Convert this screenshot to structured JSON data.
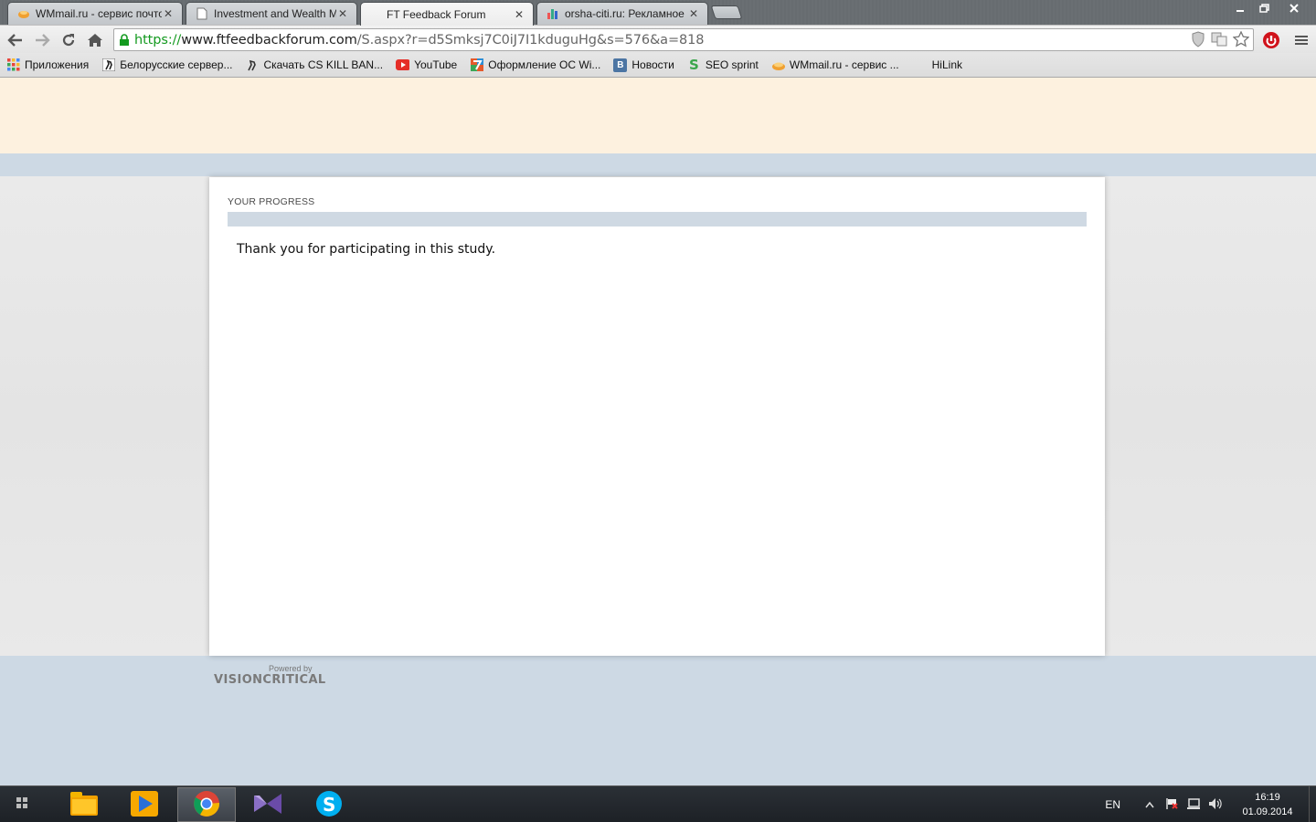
{
  "browser": {
    "tabs": [
      {
        "title": "WMmail.ru - сервис почтов",
        "icon": "wmmail-icon",
        "active": false
      },
      {
        "title": "Investment and Wealth Ma",
        "icon": "page-icon",
        "active": false
      },
      {
        "title": "FT Feedback Forum",
        "icon": "none",
        "active": true
      },
      {
        "title": "orsha-citi.ru: Рекламное аг",
        "icon": "chart-icon",
        "active": false
      }
    ],
    "close_glyph": "✕",
    "url": {
      "scheme": "https://",
      "host": "www.ftfeedbackforum.com",
      "path": "/S.aspx?r=d5Smksj7C0iJ7I1kduguHg&s=576&a=818"
    },
    "bookmarks": [
      {
        "label": "Приложения",
        "icon": "apps-icon",
        "color": "#e8453c"
      },
      {
        "label": "Белорусские сервер...",
        "icon": "cs-icon",
        "color": "#333333"
      },
      {
        "label": "Скачать CS KILL BAN...",
        "icon": "cs-icon",
        "color": "#333333"
      },
      {
        "label": "YouTube",
        "icon": "youtube-icon",
        "color": "#e52d27"
      },
      {
        "label": "Оформление ОС Wi...",
        "icon": "seven-icon",
        "color": "#2c8ed6"
      },
      {
        "label": "Новости",
        "icon": "vk-icon",
        "color": "#4c75a3"
      },
      {
        "label": "SEO sprint",
        "icon": "seo-sprint-icon",
        "color": "#3aa64b"
      },
      {
        "label": "WMmail.ru - сервис ...",
        "icon": "wmmail-icon",
        "color": "#f0a030"
      },
      {
        "label": "HiLink",
        "icon": "none",
        "color": ""
      }
    ]
  },
  "survey": {
    "progress_label": "YOUR PROGRESS",
    "progress_value": 0,
    "thank_you": "Thank you for participating in this study.",
    "powered_by": "Powered by",
    "brand": "VISIONCRITICAL"
  },
  "taskbar": {
    "apps": [
      {
        "name": "file-manager",
        "icon": "folder-icon",
        "active": false
      },
      {
        "name": "media-player",
        "icon": "player-icon",
        "active": false
      },
      {
        "name": "chrome",
        "icon": "chrome-icon",
        "active": true
      },
      {
        "name": "visual-studio",
        "icon": "vs-icon",
        "active": false
      },
      {
        "name": "skype",
        "icon": "skype-icon",
        "active": false
      }
    ],
    "language": "EN",
    "time": "16:19",
    "date": "01.09.2014"
  },
  "colors": {
    "header_bg": "#fdf1df",
    "page_bg": "#cdd9e4",
    "progress_track": "#cfd9e3",
    "url_scheme": "#139a1f"
  }
}
